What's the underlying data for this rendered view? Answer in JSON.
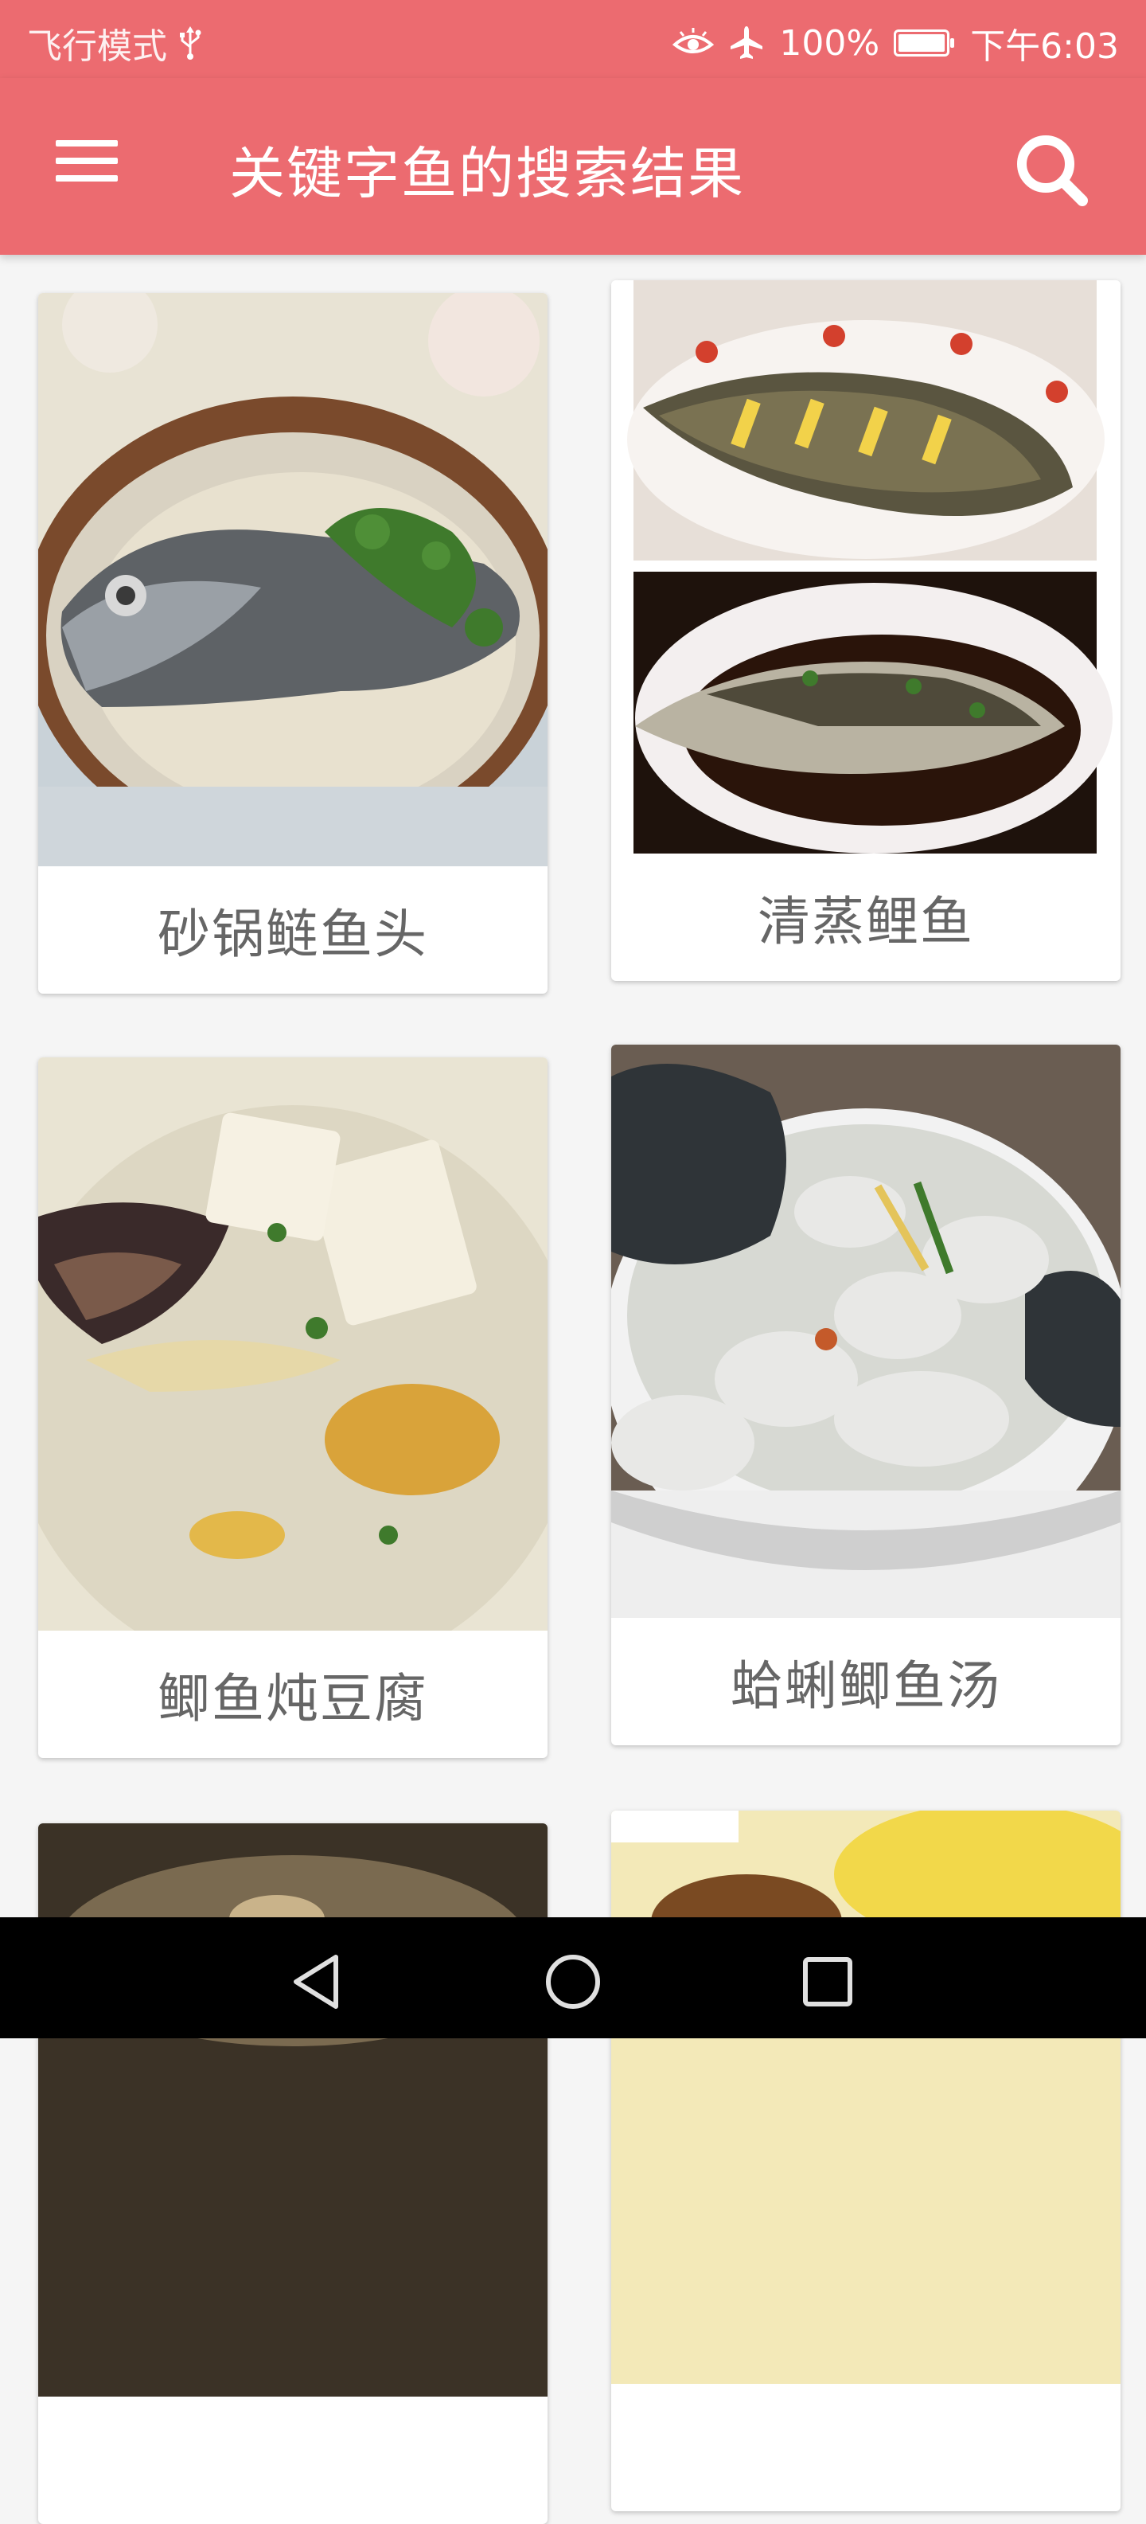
{
  "status_bar": {
    "left_text": "飞行模式",
    "usb_icon": "usb-icon",
    "eye_icon": "eye-comfort-icon",
    "airplane_icon": "airplane-icon",
    "battery_percent": "100%",
    "time": "下午6:03",
    "background_color": "#ec6b70"
  },
  "app_bar": {
    "title": "关键字鱼的搜索结果",
    "menu_icon": "hamburger-menu-icon",
    "search_icon": "search-icon",
    "background_color": "#ec6b70"
  },
  "results": [
    {
      "title": "砂锅鲢鱼头",
      "image": "clay-pot-fish-head-photo"
    },
    {
      "title": "清蒸鲤鱼",
      "image": "steamed-carp-photo"
    },
    {
      "title": "鲫鱼炖豆腐",
      "image": "crucian-carp-tofu-photo"
    },
    {
      "title": "蛤蜊鲫鱼汤",
      "image": "clam-fish-soup-photo"
    },
    {
      "title": "",
      "image": "dish-photo"
    },
    {
      "title": "",
      "image": "dish-photo"
    }
  ],
  "nav_bar": {
    "back_icon": "back-triangle-icon",
    "home_icon": "home-circle-icon",
    "recents_icon": "recents-square-icon"
  }
}
